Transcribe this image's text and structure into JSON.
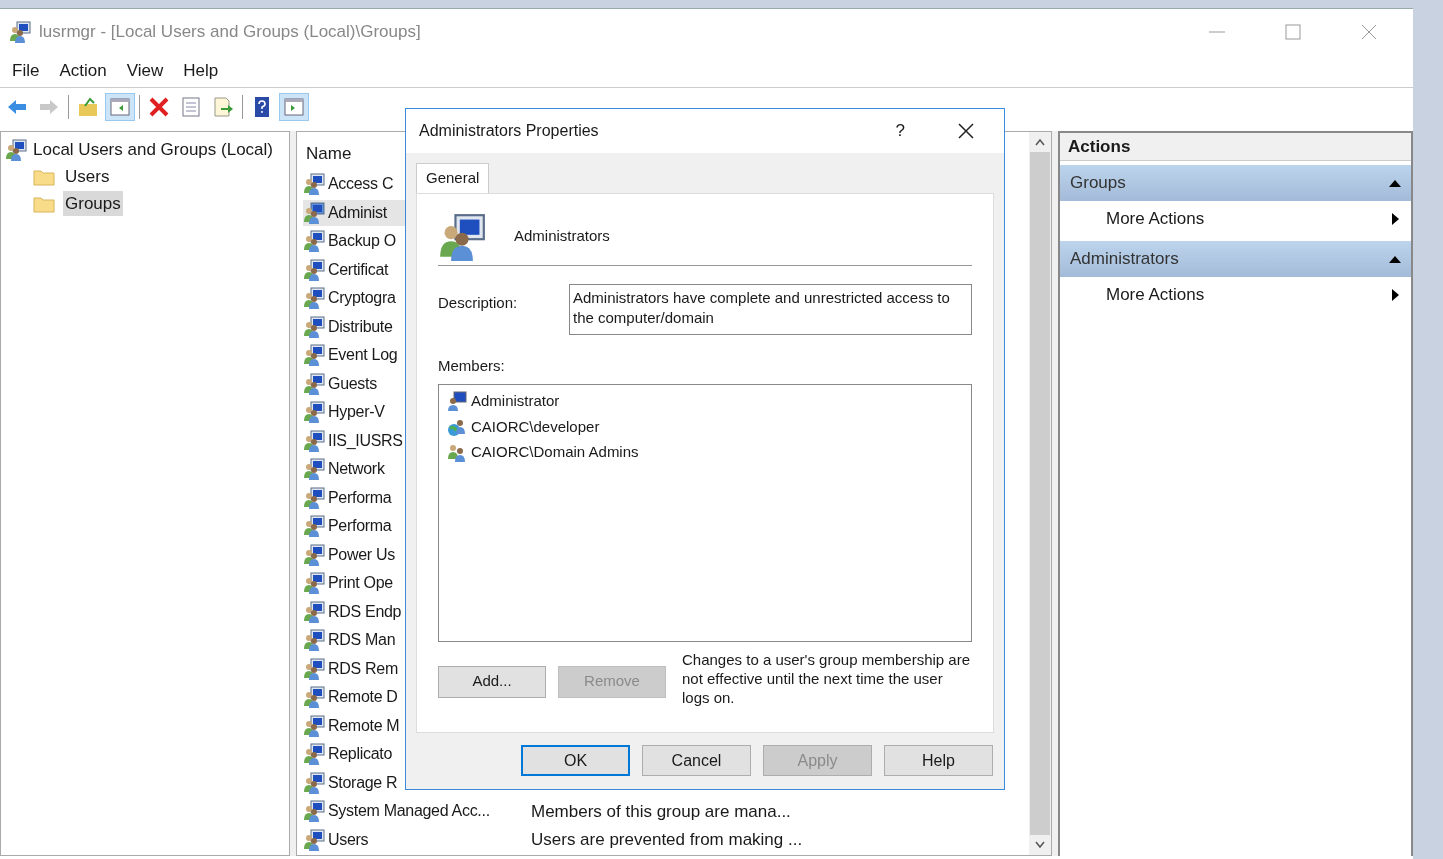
{
  "window": {
    "title": "lusrmgr - [Local Users and Groups (Local)\\Groups]"
  },
  "menu": [
    "File",
    "Action",
    "View",
    "Help"
  ],
  "toolbar": [
    {
      "kind": "back",
      "pressed": false,
      "disabled": false
    },
    {
      "kind": "forward",
      "pressed": false,
      "disabled": true
    },
    {
      "kind": "up",
      "pressed": false,
      "disabled": false
    },
    {
      "kind": "tree",
      "pressed": true,
      "disabled": false
    },
    {
      "kind": "delete",
      "pressed": false,
      "disabled": false
    },
    {
      "kind": "properties",
      "pressed": false,
      "disabled": false
    },
    {
      "kind": "export",
      "pressed": false,
      "disabled": false
    },
    {
      "kind": "help",
      "pressed": false,
      "disabled": false
    },
    {
      "kind": "actionpane",
      "pressed": true,
      "disabled": false
    }
  ],
  "tree": {
    "label": "Local Users and Groups (Local)",
    "children": [
      {
        "label": "Users",
        "selected": false
      },
      {
        "label": "Groups",
        "selected": true
      }
    ]
  },
  "list": {
    "columns": [
      "Name"
    ],
    "rows": [
      {
        "name": "Access C",
        "selected": false
      },
      {
        "name": "Administ",
        "selected": true
      },
      {
        "name": "Backup O",
        "selected": false
      },
      {
        "name": "Certificat",
        "selected": false
      },
      {
        "name": "Cryptogra",
        "selected": false
      },
      {
        "name": "Distribute",
        "selected": false
      },
      {
        "name": "Event Log",
        "selected": false
      },
      {
        "name": "Guests",
        "selected": false
      },
      {
        "name": "Hyper-V",
        "selected": false
      },
      {
        "name": "IIS_IUSRS",
        "selected": false
      },
      {
        "name": "Network",
        "selected": false
      },
      {
        "name": "Performa",
        "selected": false
      },
      {
        "name": "Performa",
        "selected": false
      },
      {
        "name": "Power Us",
        "selected": false
      },
      {
        "name": "Print Ope",
        "selected": false
      },
      {
        "name": "RDS Endp",
        "selected": false
      },
      {
        "name": "RDS Man",
        "selected": false
      },
      {
        "name": "RDS Rem",
        "selected": false
      },
      {
        "name": "Remote D",
        "selected": false
      },
      {
        "name": "Remote M",
        "selected": false
      },
      {
        "name": "Replicato",
        "selected": false
      },
      {
        "name": "Storage R",
        "selected": false
      },
      {
        "name": "System Managed Acc...",
        "description": "Members of this group are mana...",
        "selected": false
      },
      {
        "name": "Users",
        "description": "Users are prevented from making ...",
        "selected": false
      }
    ]
  },
  "actions": {
    "title": "Actions",
    "sections": [
      {
        "title": "Groups",
        "expanded": true,
        "items": [
          "More Actions"
        ]
      },
      {
        "title": "Administrators",
        "expanded": true,
        "items": [
          "More Actions"
        ]
      }
    ]
  },
  "dialog": {
    "title": "Administrators Properties",
    "help": "?",
    "tabs": [
      {
        "label": "General",
        "selected": true
      }
    ],
    "group_name": "Administrators",
    "description_label": "Description:",
    "description": "Administrators have complete and unrestricted access to the computer/domain",
    "members_label": "Members:",
    "members": [
      {
        "kind": "local-user",
        "name": "Administrator"
      },
      {
        "kind": "domain-user",
        "name": "CAIORC\\developer"
      },
      {
        "kind": "domain-group",
        "name": "CAIORC\\Domain Admins"
      }
    ],
    "member_buttons": [
      {
        "label": "Add...",
        "disabled": false
      },
      {
        "label": "Remove",
        "disabled": true
      }
    ],
    "note": "Changes to a user's group membership are not effective until the next time the user logs on.",
    "buttons": [
      {
        "label": "OK",
        "default": true,
        "disabled": false
      },
      {
        "label": "Cancel",
        "default": false,
        "disabled": false
      },
      {
        "label": "Apply",
        "default": false,
        "disabled": true
      },
      {
        "label": "Help",
        "default": false,
        "disabled": false
      }
    ]
  }
}
